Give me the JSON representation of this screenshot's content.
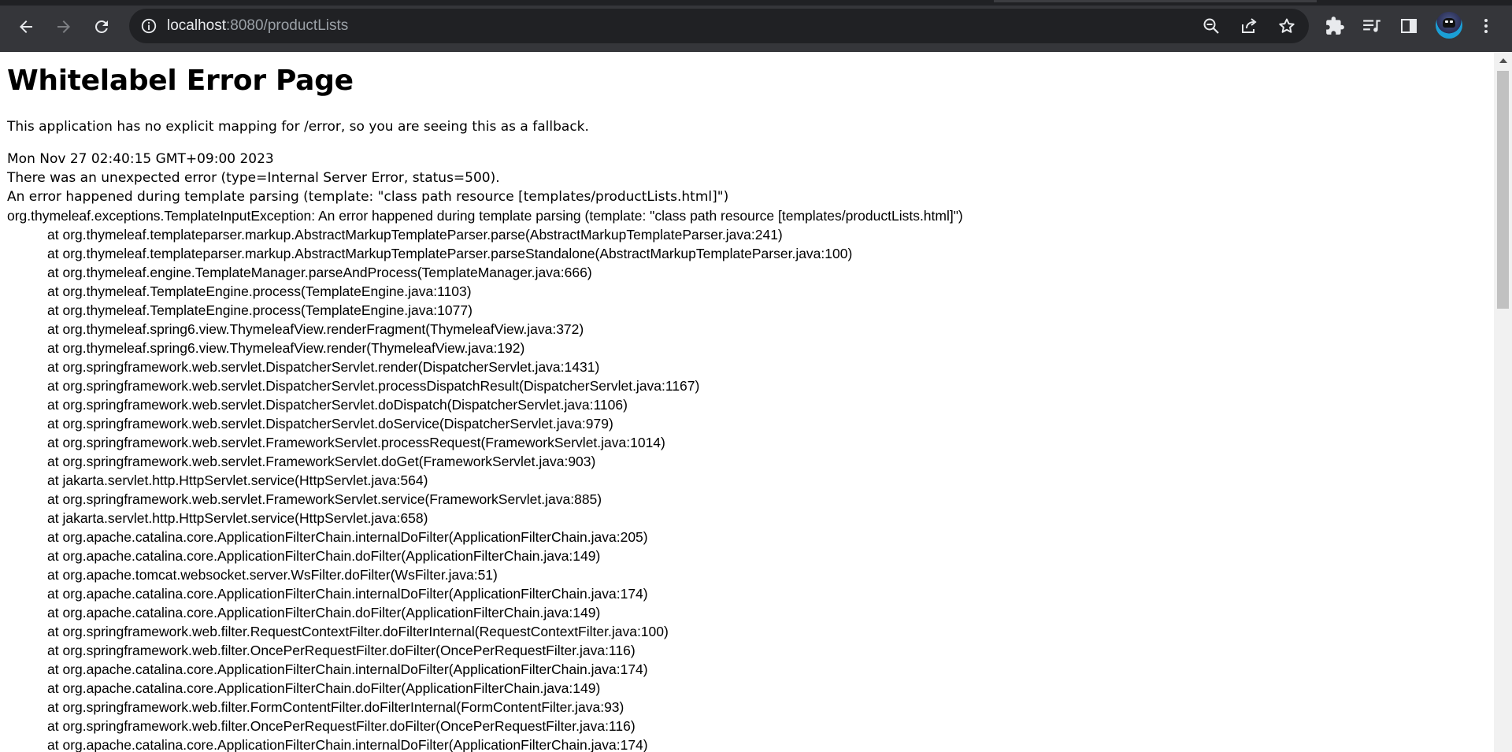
{
  "browser": {
    "url_host": "localhost",
    "url_rest": ":8080/productLists",
    "icons": {
      "back": "back-arrow-icon",
      "forward": "forward-arrow-icon",
      "reload": "reload-icon",
      "site_info": "info-icon",
      "zoom": "zoom-out-icon",
      "share": "share-icon",
      "bookmark": "star-icon",
      "extensions": "puzzle-icon",
      "media": "media-queue-icon",
      "side_panel": "side-panel-icon",
      "profile": "avatar",
      "menu": "kebab-menu-icon"
    },
    "colors": {
      "toolbar": "#35363a",
      "omnibox": "#202124",
      "icon": "#e8eaed"
    }
  },
  "page": {
    "title": "Whitelabel Error Page",
    "fallback_text": "This application has no explicit mapping for /error, so you are seeing this as a fallback.",
    "timestamp": "Mon Nov 27 02:40:15 GMT+09:00 2023",
    "error_summary": "There was an unexpected error (type=Internal Server Error, status=500).",
    "error_message": "An error happened during template parsing (template: \"class path resource [templates/productLists.html]\")",
    "exception": "org.thymeleaf.exceptions.TemplateInputException: An error happened during template parsing (template: \"class path resource [templates/productLists.html]\")",
    "stack_trace": [
      "at org.thymeleaf.templateparser.markup.AbstractMarkupTemplateParser.parse(AbstractMarkupTemplateParser.java:241)",
      "at org.thymeleaf.templateparser.markup.AbstractMarkupTemplateParser.parseStandalone(AbstractMarkupTemplateParser.java:100)",
      "at org.thymeleaf.engine.TemplateManager.parseAndProcess(TemplateManager.java:666)",
      "at org.thymeleaf.TemplateEngine.process(TemplateEngine.java:1103)",
      "at org.thymeleaf.TemplateEngine.process(TemplateEngine.java:1077)",
      "at org.thymeleaf.spring6.view.ThymeleafView.renderFragment(ThymeleafView.java:372)",
      "at org.thymeleaf.spring6.view.ThymeleafView.render(ThymeleafView.java:192)",
      "at org.springframework.web.servlet.DispatcherServlet.render(DispatcherServlet.java:1431)",
      "at org.springframework.web.servlet.DispatcherServlet.processDispatchResult(DispatcherServlet.java:1167)",
      "at org.springframework.web.servlet.DispatcherServlet.doDispatch(DispatcherServlet.java:1106)",
      "at org.springframework.web.servlet.DispatcherServlet.doService(DispatcherServlet.java:979)",
      "at org.springframework.web.servlet.FrameworkServlet.processRequest(FrameworkServlet.java:1014)",
      "at org.springframework.web.servlet.FrameworkServlet.doGet(FrameworkServlet.java:903)",
      "at jakarta.servlet.http.HttpServlet.service(HttpServlet.java:564)",
      "at org.springframework.web.servlet.FrameworkServlet.service(FrameworkServlet.java:885)",
      "at jakarta.servlet.http.HttpServlet.service(HttpServlet.java:658)",
      "at org.apache.catalina.core.ApplicationFilterChain.internalDoFilter(ApplicationFilterChain.java:205)",
      "at org.apache.catalina.core.ApplicationFilterChain.doFilter(ApplicationFilterChain.java:149)",
      "at org.apache.tomcat.websocket.server.WsFilter.doFilter(WsFilter.java:51)",
      "at org.apache.catalina.core.ApplicationFilterChain.internalDoFilter(ApplicationFilterChain.java:174)",
      "at org.apache.catalina.core.ApplicationFilterChain.doFilter(ApplicationFilterChain.java:149)",
      "at org.springframework.web.filter.RequestContextFilter.doFilterInternal(RequestContextFilter.java:100)",
      "at org.springframework.web.filter.OncePerRequestFilter.doFilter(OncePerRequestFilter.java:116)",
      "at org.apache.catalina.core.ApplicationFilterChain.internalDoFilter(ApplicationFilterChain.java:174)",
      "at org.apache.catalina.core.ApplicationFilterChain.doFilter(ApplicationFilterChain.java:149)",
      "at org.springframework.web.filter.FormContentFilter.doFilterInternal(FormContentFilter.java:93)",
      "at org.springframework.web.filter.OncePerRequestFilter.doFilter(OncePerRequestFilter.java:116)",
      "at org.apache.catalina.core.ApplicationFilterChain.internalDoFilter(ApplicationFilterChain.java:174)"
    ]
  }
}
